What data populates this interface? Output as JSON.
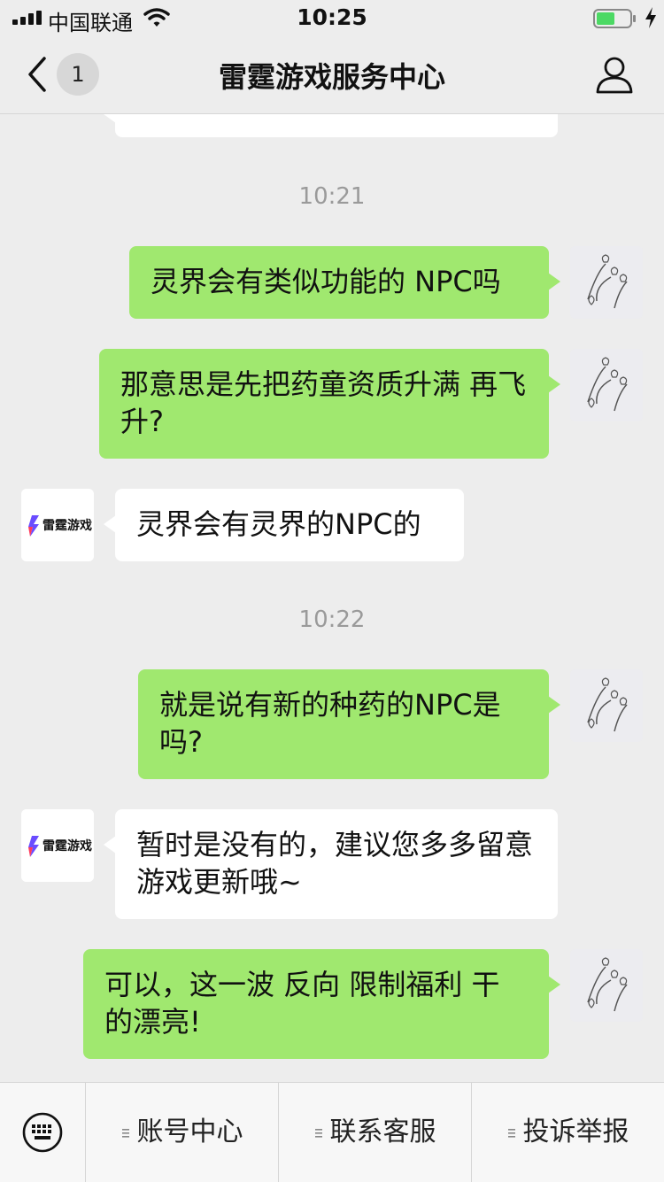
{
  "status_bar": {
    "carrier": "中国联通",
    "time": "10:25"
  },
  "nav": {
    "back_badge": "1",
    "title": "雷霆游戏服务中心"
  },
  "chat": {
    "partial_top_text": "",
    "timestamps": [
      "10:21",
      "10:22"
    ],
    "messages": [
      {
        "from": "user",
        "text": "灵界会有类似功能的 NPC吗"
      },
      {
        "from": "user",
        "text": "那意思是先把药童资质升满 再飞升?"
      },
      {
        "from": "service",
        "text": "灵界会有灵界的NPC的"
      },
      {
        "from": "user",
        "text": "就是说有新的种药的NPC是吗?"
      },
      {
        "from": "service",
        "text": "暂时是没有的，建议您多多留意游戏更新哦~"
      },
      {
        "from": "user",
        "text": "可以，这一波 反向 限制福利 干的漂亮!"
      }
    ],
    "service_avatar_text": "雷霆游戏"
  },
  "bottom_menu": {
    "items": [
      "账号中心",
      "联系客服",
      "投诉举报"
    ]
  },
  "colors": {
    "background": "#ededed",
    "outgoing_bubble": "#a0e86f",
    "incoming_bubble": "#ffffff",
    "timestamp": "#9a9a9a"
  },
  "icons": {
    "nav_back": "chevron-left-icon",
    "nav_profile": "person-icon",
    "keyboard": "keyboard-icon",
    "menu_dots": "menu-lines-icon"
  }
}
